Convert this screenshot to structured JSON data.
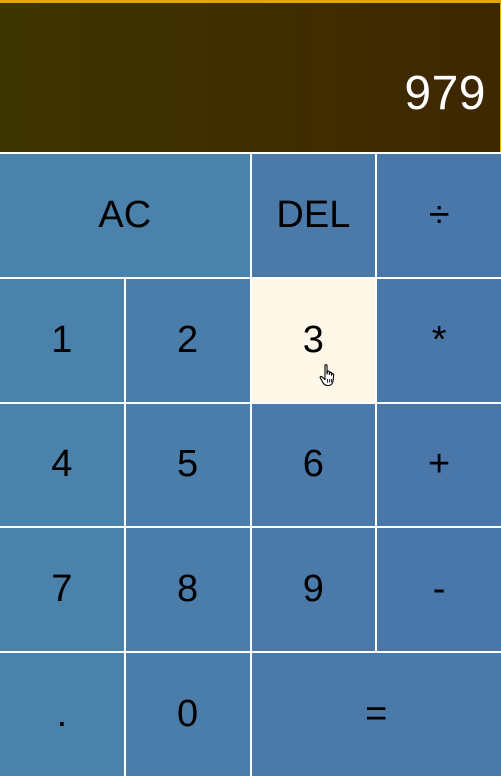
{
  "display": {
    "previous_operand": "",
    "current_operand": "979"
  },
  "keys": {
    "all_clear": "AC",
    "delete": "DEL",
    "divide": "÷",
    "one": "1",
    "two": "2",
    "three": "3",
    "multiply": "*",
    "four": "4",
    "five": "5",
    "six": "6",
    "plus": "+",
    "seven": "7",
    "eight": "8",
    "nine": "9",
    "minus": "-",
    "decimal": ".",
    "zero": "0",
    "equals": "="
  },
  "cursor": {
    "icon": "hand-pointer-icon",
    "hovered_key": "3"
  },
  "colors": {
    "display_bg": "#3e3100",
    "display_border": "#e2a800",
    "key_bg": "#4a7fa8",
    "key_hover_bg": "#fff8e9",
    "key_text": "#000000",
    "display_text": "#ffffff"
  }
}
